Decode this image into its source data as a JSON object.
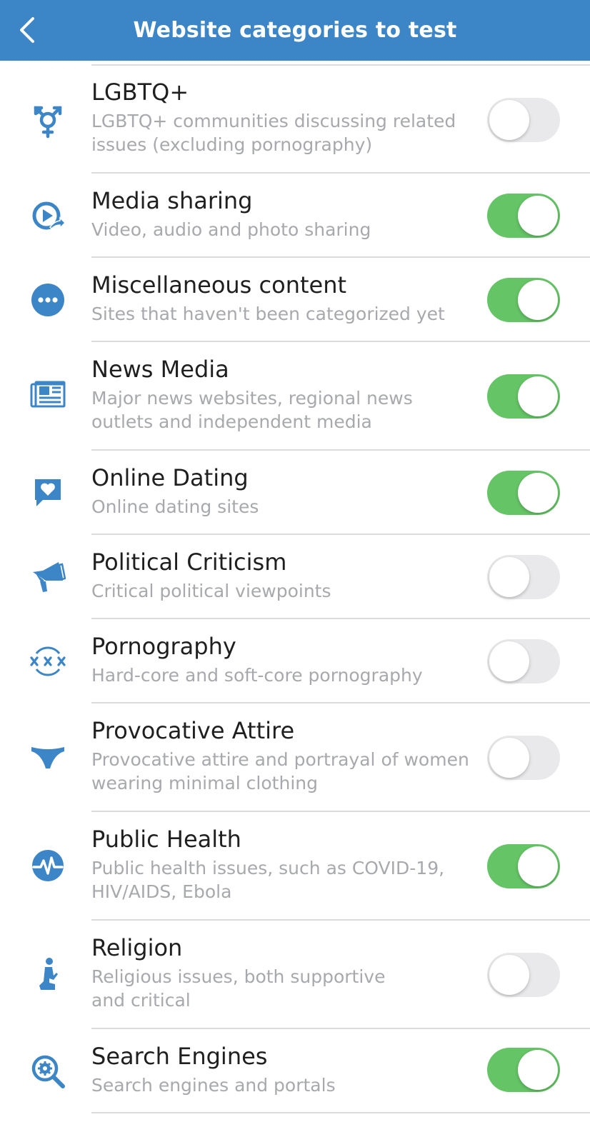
{
  "header": {
    "title": "Website categories to test",
    "back_icon": "chevron-left-icon"
  },
  "colors": {
    "header_bg": "#3c85c6",
    "icon": "#3c85c6",
    "toggle_on": "#65c466",
    "toggle_off": "#e9e9eb"
  },
  "categories": [
    {
      "title": "LGBTQ+",
      "description": "LGBTQ+ communities discussing related issues (excluding pornography)",
      "enabled": false,
      "icon": "transgender-symbol-icon"
    },
    {
      "title": "Media sharing",
      "description": "Video, audio and photo sharing",
      "enabled": true,
      "icon": "media-share-icon"
    },
    {
      "title": "Miscellaneous content",
      "description": "Sites that haven't been categorized yet",
      "enabled": true,
      "icon": "ellipsis-circle-icon"
    },
    {
      "title": "News Media",
      "description": "Major news websites, regional news outlets and independent media",
      "enabled": true,
      "icon": "newspaper-icon"
    },
    {
      "title": "Online Dating",
      "description": "Online dating sites",
      "enabled": true,
      "icon": "heart-chat-icon"
    },
    {
      "title": "Political Criticism",
      "description": "Critical political viewpoints",
      "enabled": false,
      "icon": "megaphone-icon"
    },
    {
      "title": "Pornography",
      "description": "Hard-core and soft-core pornography",
      "enabled": false,
      "icon": "xxx-icon"
    },
    {
      "title": "Provocative Attire",
      "description": "Provocative attire and portrayal of women wearing minimal clothing",
      "enabled": false,
      "icon": "underwear-icon"
    },
    {
      "title": "Public Health",
      "description": "Public health issues, such as COVID-19, HIV/AIDS, Ebola",
      "enabled": true,
      "icon": "heartbeat-icon"
    },
    {
      "title": "Religion",
      "description": "Religious issues, both supportive and critical",
      "enabled": false,
      "icon": "praying-person-icon"
    },
    {
      "title": "Search Engines",
      "description": "Search engines and portals",
      "enabled": true,
      "icon": "search-gear-icon"
    }
  ]
}
